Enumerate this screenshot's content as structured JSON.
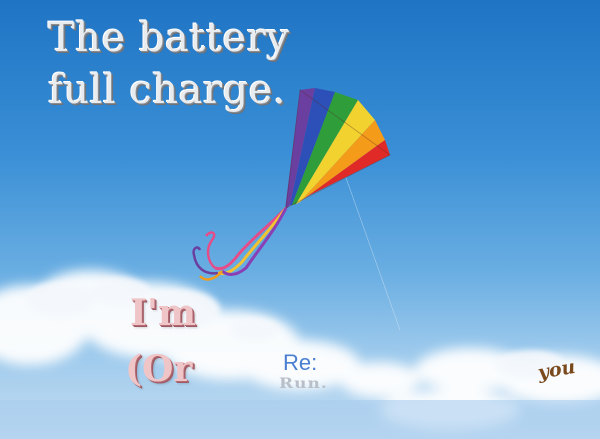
{
  "scene": {
    "sky_colors": [
      "#1f74c4",
      "#3a8fd6",
      "#6aaee2",
      "#c6def2"
    ],
    "kite_colors": [
      "#6b3fa0",
      "#2d4fb8",
      "#2e9d3a",
      "#f2d22e",
      "#f59b1a",
      "#e02a28"
    ]
  },
  "headline": {
    "line1": "The  battery",
    "line2": "full  charge."
  },
  "texts": {
    "im": "I'm",
    "or": "(Or",
    "re": "Re:",
    "run": "Run.",
    "you": "you"
  }
}
